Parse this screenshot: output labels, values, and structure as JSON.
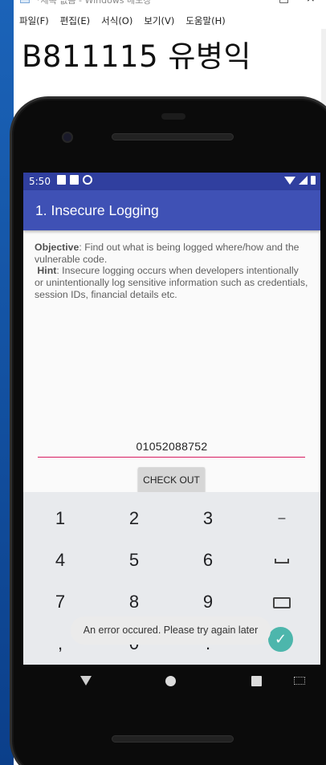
{
  "notepad": {
    "title": "*제목 없음 - Windows 메모장",
    "menus": [
      "파일(F)",
      "편집(E)",
      "서식(O)",
      "보기(V)",
      "도움말(H)"
    ],
    "text": "B811115 유병익"
  },
  "phone": {
    "status_time": "5:50",
    "app_title": "1. Insecure Logging",
    "objective_label": "Objective",
    "objective_text": ": Find out what is being logged where/how and the vulnerable code.",
    "hint_label": "Hint",
    "hint_text": ": Insecure logging occurs when developers intentionally or unintentionally log sensitive information such as credentials, session IDs, financial details etc.",
    "input_value": "01052088752",
    "check_out_button": "CHECK OUT",
    "toast": "An error occured. Please try again later",
    "keys": {
      "k1": "1",
      "k2": "2",
      "k3": "3",
      "minus": "–",
      "k4": "4",
      "k5": "5",
      "k6": "6",
      "k7": "7",
      "k8": "8",
      "k9": "9",
      "comma": ",",
      "k0": "0",
      "period": "."
    }
  },
  "colors": {
    "status_bar": "#303f9f",
    "app_bar": "#3f51b5",
    "input_underline": "#d81b60",
    "done_key": "#4db6ac"
  },
  "icons": [
    "back-triangle-icon",
    "home-circle-icon",
    "recents-square-icon",
    "keyboard-icon",
    "backspace-icon",
    "space-icon",
    "checkmark-icon",
    "wifi-icon",
    "signal-icon",
    "battery-icon"
  ]
}
